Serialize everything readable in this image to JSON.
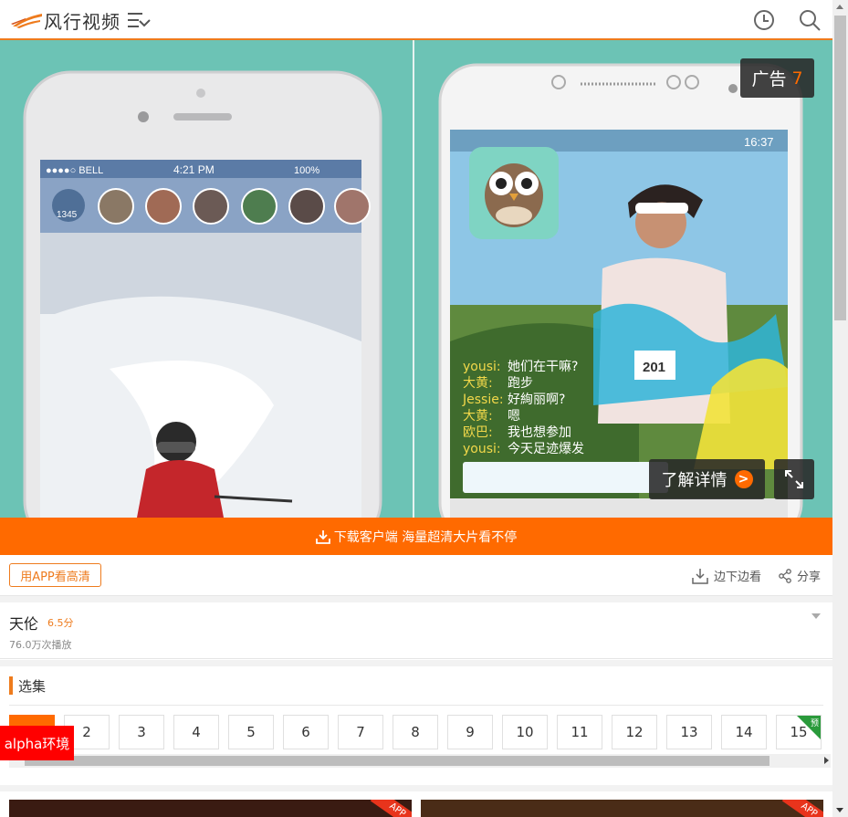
{
  "header": {
    "logo_text": "风行视频",
    "menu_icon": "menu-list-icon",
    "history_icon": "clock-icon",
    "search_icon": "search-icon"
  },
  "player": {
    "ad_label": "广告",
    "ad_countdown": "7",
    "learn_more": "了解详情",
    "learn_more_arrow": ">",
    "phone_status_left": "●●●●○ BELL",
    "phone_status_time": "4:21 PM",
    "phone_status_battery": "100%",
    "viewer_count": "1345",
    "android_time": "16:37",
    "chat_lines": [
      {
        "name": "yousi:",
        "text": "她们在干嘛?"
      },
      {
        "name": "大黄:",
        "text": "跑步"
      },
      {
        "name": "Jessie:",
        "text": "好絢丽啊?"
      },
      {
        "name": "大黄:",
        "text": "嗯"
      },
      {
        "name": "欧巴:",
        "text": "我也想参加"
      },
      {
        "name": "yousi:",
        "text": "今天足迹爆发"
      }
    ],
    "bib_number": "201"
  },
  "download_bar": {
    "text": "下载客户端 海量超清大片看不停"
  },
  "toolbar": {
    "app_hd": "用APP看高清",
    "download_watch": "边下边看",
    "share": "分享"
  },
  "show": {
    "title": "天伦",
    "score": "6.5分",
    "plays": "76.0万次播放"
  },
  "episodes": {
    "label": "选集",
    "items": [
      "1",
      "2",
      "3",
      "4",
      "5",
      "6",
      "7",
      "8",
      "9",
      "10",
      "11",
      "12",
      "13",
      "14",
      "15"
    ],
    "active_index": 0,
    "preview_tag": "预"
  },
  "alpha_badge": "alpha环境",
  "thumbs": {
    "tag": "APP"
  },
  "colors": {
    "accent": "#ff6a00",
    "brand_line": "#ee7b1d",
    "video_bg": "#6cc3b5"
  }
}
